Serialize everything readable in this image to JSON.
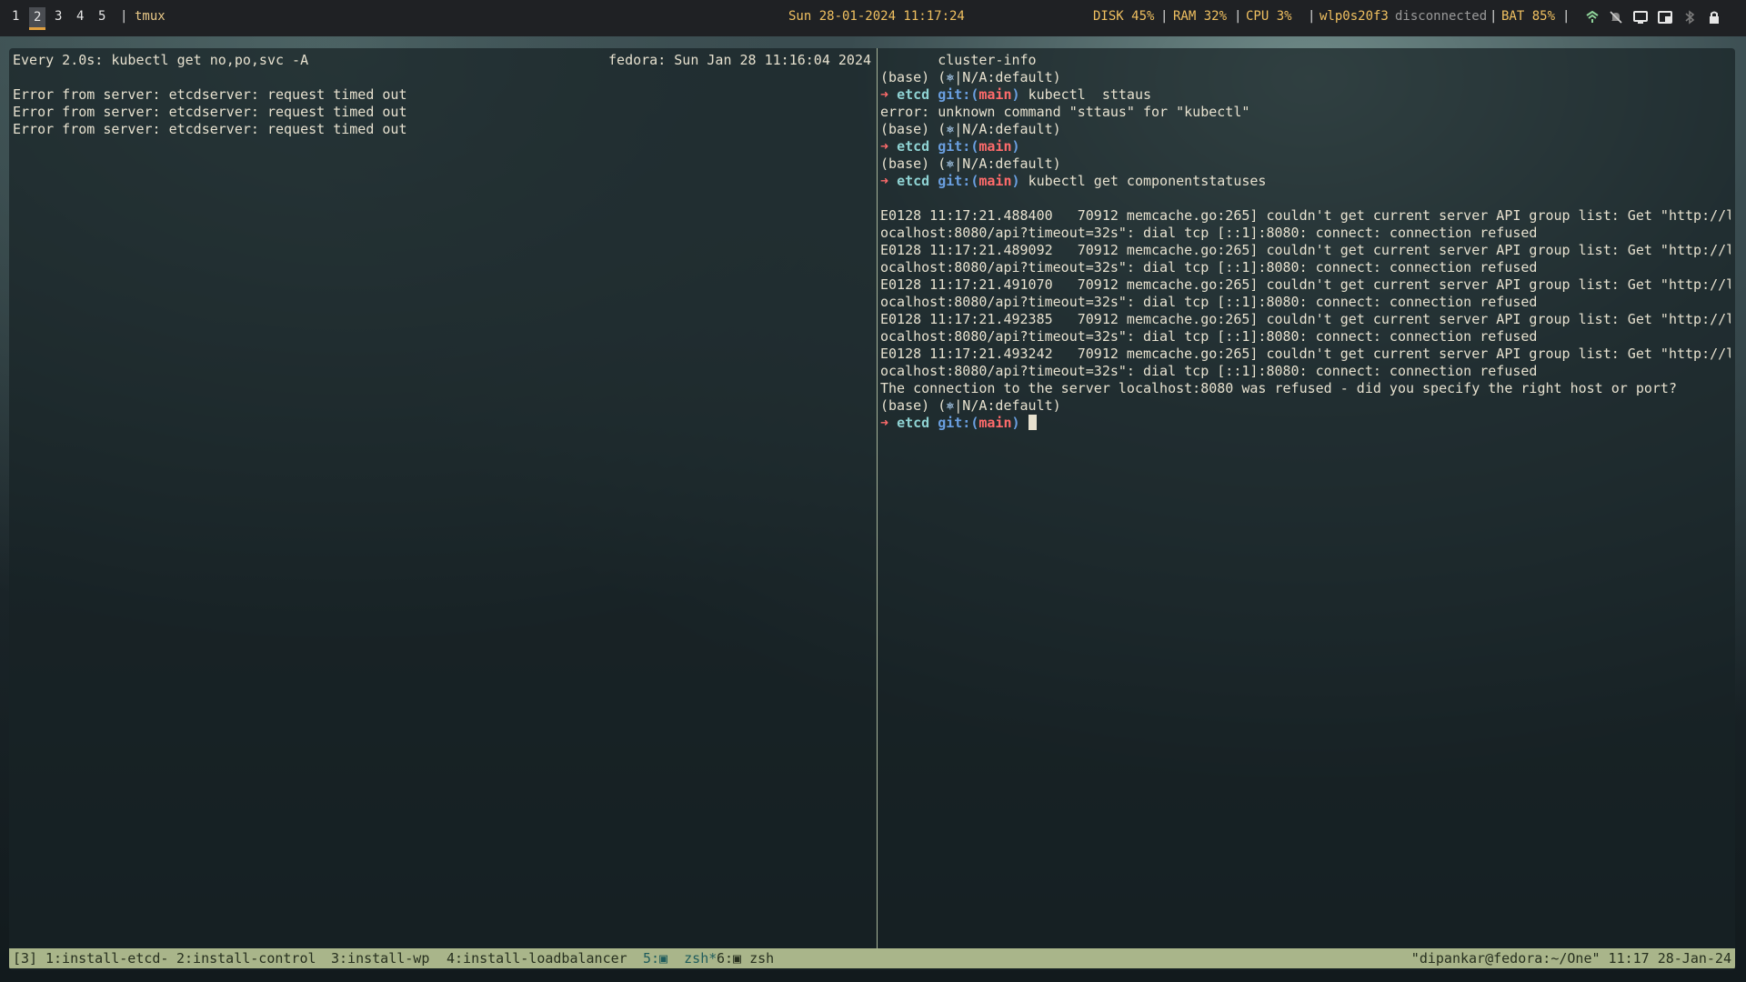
{
  "topbar": {
    "workspaces": [
      "1",
      "2",
      "3",
      "4",
      "5"
    ],
    "active_workspace": "2",
    "separator": "|",
    "tmux_label": "tmux",
    "clock": "Sun 28-01-2024 11:17:24",
    "stats": {
      "disk": "DISK 45%",
      "ram": "RAM 32%",
      "cpu": "CPU  3%",
      "wifi_iface": "wlp0s20f3",
      "wifi_state": "disconnected",
      "battery": "BAT 85%",
      "sep": "|"
    },
    "tray_icons": [
      "network-icon",
      "muted-bell-icon",
      "screen-icon",
      "window-icon",
      "bluetooth-icon",
      "lock-icon"
    ]
  },
  "left_pane": {
    "watch_header": "Every 2.0s: kubectl get no,po,svc -A",
    "watch_time": "fedora: Sun Jan 28 11:16:04 2024",
    "lines": [
      "",
      "Error from server: etcdserver: request timed out",
      "Error from server: etcdserver: request timed out",
      "Error from server: etcdserver: request timed out"
    ]
  },
  "right_pane": {
    "top_line": "       cluster-info",
    "prompt": {
      "env": "(base) (",
      "helm": "⎈",
      "ctx": "|N/A:default)",
      "arrow": "➜",
      "dir": "etcd",
      "git": "git:(",
      "branch": "main",
      "close": ")"
    },
    "cmd1": "kubectl  sttaus",
    "error1": "error: unknown command \"sttaus\" for \"kubectl\"",
    "cmd3": "kubectl get componentstatuses",
    "log_lines": [
      "E0128 11:17:21.488400   70912 memcache.go:265] couldn't get current server API group list: Get \"http://l",
      "ocalhost:8080/api?timeout=32s\": dial tcp [::1]:8080: connect: connection refused",
      "E0128 11:17:21.489092   70912 memcache.go:265] couldn't get current server API group list: Get \"http://l",
      "ocalhost:8080/api?timeout=32s\": dial tcp [::1]:8080: connect: connection refused",
      "E0128 11:17:21.491070   70912 memcache.go:265] couldn't get current server API group list: Get \"http://l",
      "ocalhost:8080/api?timeout=32s\": dial tcp [::1]:8080: connect: connection refused",
      "E0128 11:17:21.492385   70912 memcache.go:265] couldn't get current server API group list: Get \"http://l",
      "ocalhost:8080/api?timeout=32s\": dial tcp [::1]:8080: connect: connection refused",
      "E0128 11:17:21.493242   70912 memcache.go:265] couldn't get current server API group list: Get \"http://l",
      "ocalhost:8080/api?timeout=32s\": dial tcp [::1]:8080: connect: connection refused"
    ],
    "refused_line": "The connection to the server localhost:8080 was refused - did you specify the right host or port?"
  },
  "tmux_status": {
    "session": "[3]",
    "windows": [
      "1:install-etcd-",
      "2:install-control",
      "3:install-wp",
      "4:install-loadbalancer",
      "5:▣  zsh*",
      "6:▣ zsh"
    ],
    "right": "\"dipankar@fedora:~/One\" 11:17 28-Jan-24"
  }
}
